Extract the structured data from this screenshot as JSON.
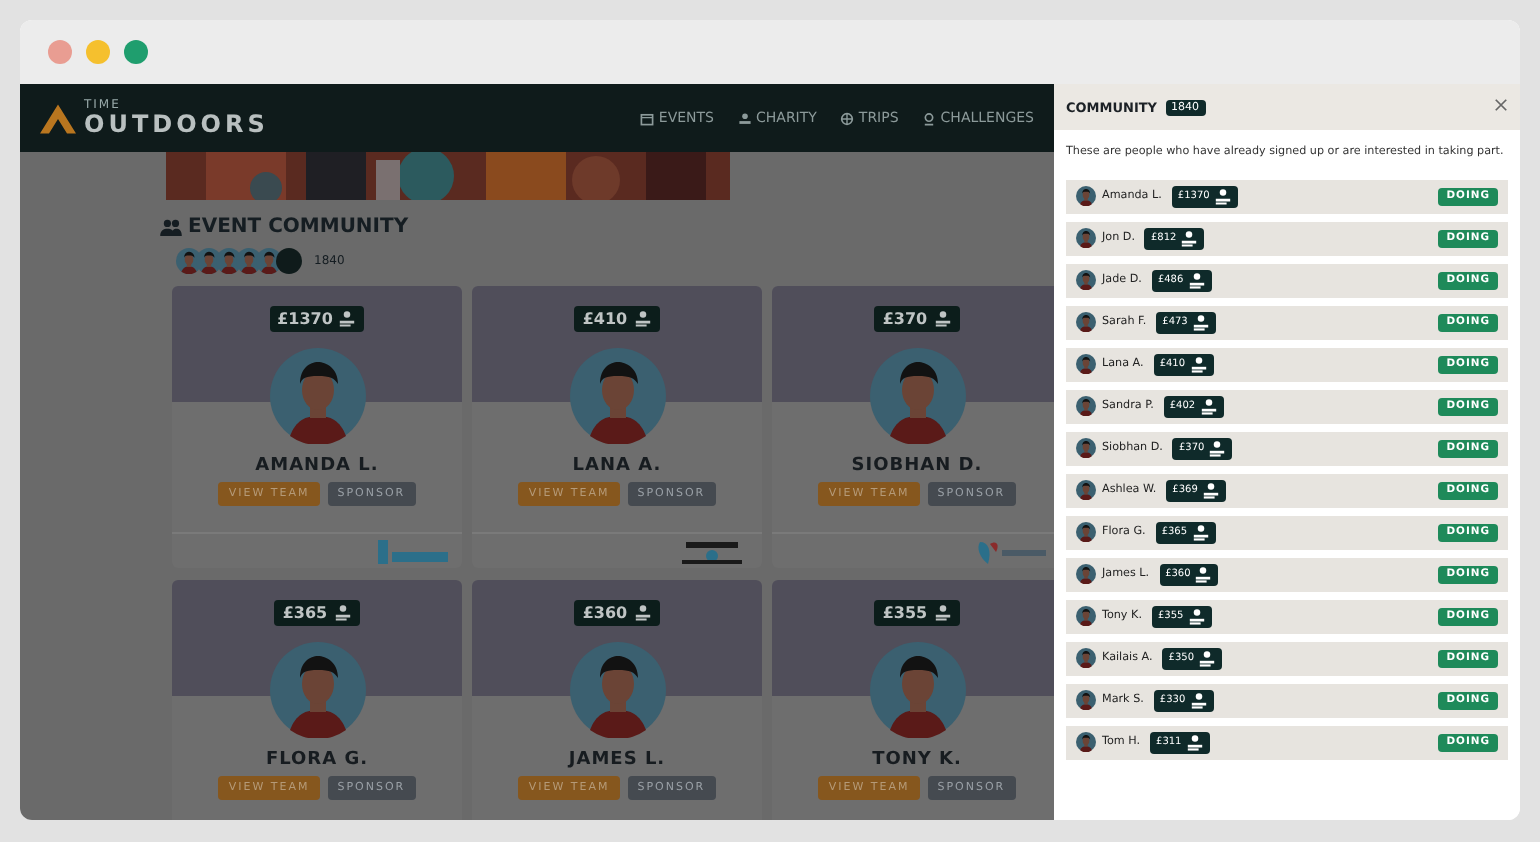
{
  "window": {
    "controls": [
      {
        "color": "#e99d92"
      },
      {
        "color": "#f5c02e"
      },
      {
        "color": "#1f9e6e"
      }
    ]
  },
  "nav": {
    "brand_small": "TIME",
    "brand": "OUTDOORS",
    "items": [
      {
        "label": "EVENTS"
      },
      {
        "label": "CHARITY"
      },
      {
        "label": "TRIPS"
      },
      {
        "label": "CHALLENGES"
      }
    ]
  },
  "community": {
    "heading": "EVENT COMMUNITY",
    "count": "1840"
  },
  "cards": [
    {
      "name": "AMANDA L.",
      "amount": "£1370",
      "buttons": [
        "VIEW TEAM",
        "SPONSOR"
      ]
    },
    {
      "name": "LANA A.",
      "amount": "£410",
      "buttons": [
        "VIEW TEAM",
        "SPONSOR"
      ]
    },
    {
      "name": "SIOBHAN D.",
      "amount": "£370",
      "buttons": [
        "VIEW TEAM",
        "SPONSOR"
      ]
    },
    {
      "name": "FLORA G.",
      "amount": "£365",
      "buttons": [
        "VIEW TEAM",
        "SPONSOR"
      ]
    },
    {
      "name": "JAMES L.",
      "amount": "£360",
      "buttons": [
        "VIEW TEAM",
        "SPONSOR"
      ]
    },
    {
      "name": "TONY K.",
      "amount": "£355",
      "buttons": [
        "VIEW TEAM",
        "SPONSOR"
      ]
    }
  ],
  "drawer": {
    "title": "COMMUNITY",
    "count": "1840",
    "description": "These are people who have already signed up or are interested in taking part.",
    "members": [
      {
        "name": "Amanda L.",
        "amount": "£1370",
        "status": "DOING"
      },
      {
        "name": "Jon D.",
        "amount": "£812",
        "status": "DOING"
      },
      {
        "name": "Jade D.",
        "amount": "£486",
        "status": "DOING"
      },
      {
        "name": "Sarah F.",
        "amount": "£473",
        "status": "DOING"
      },
      {
        "name": "Lana A.",
        "amount": "£410",
        "status": "DOING"
      },
      {
        "name": "Sandra P.",
        "amount": "£402",
        "status": "DOING"
      },
      {
        "name": "Siobhan D.",
        "amount": "£370",
        "status": "DOING"
      },
      {
        "name": "Ashlea W.",
        "amount": "£369",
        "status": "DOING"
      },
      {
        "name": "Flora G.",
        "amount": "£365",
        "status": "DOING"
      },
      {
        "name": "James L.",
        "amount": "£360",
        "status": "DOING"
      },
      {
        "name": "Tony K.",
        "amount": "£355",
        "status": "DOING"
      },
      {
        "name": "Kailais A.",
        "amount": "£350",
        "status": "DOING"
      },
      {
        "name": "Mark S.",
        "amount": "£330",
        "status": "DOING"
      },
      {
        "name": "Tom H.",
        "amount": "£311",
        "status": "DOING"
      }
    ]
  }
}
